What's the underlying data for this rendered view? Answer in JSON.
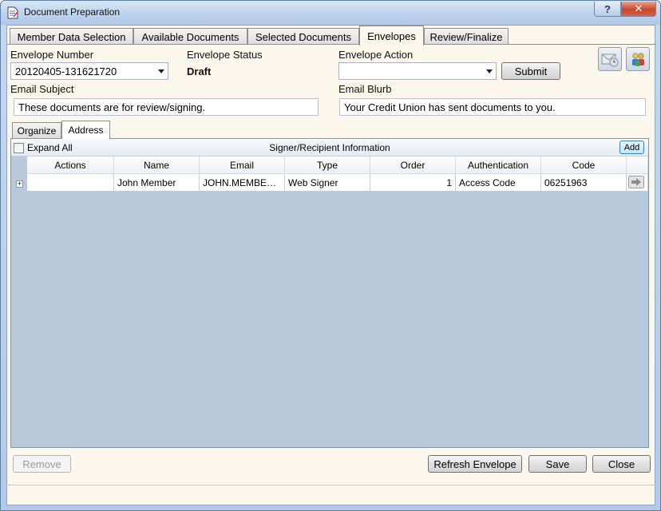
{
  "window": {
    "title": "Document Preparation",
    "help_label": "?",
    "close_label": "✕"
  },
  "tabs": [
    {
      "label": "Member Data Selection",
      "active": false
    },
    {
      "label": "Available Documents",
      "active": false
    },
    {
      "label": "Selected Documents",
      "active": false
    },
    {
      "label": "Envelopes",
      "active": true
    },
    {
      "label": "Review/Finalize",
      "active": false
    }
  ],
  "envelope": {
    "number_label": "Envelope Number",
    "number_value": "20120405-131621720",
    "status_label": "Envelope Status",
    "status_value": "Draft",
    "action_label": "Envelope Action",
    "action_value": "",
    "submit_label": "Submit",
    "subject_label": "Email Subject",
    "subject_value": "These documents are for review/signing.",
    "blurb_label": "Email Blurb",
    "blurb_value": "Your Credit Union has sent documents to you."
  },
  "toolbar_icons": [
    "mail-clock-icon",
    "people-icon"
  ],
  "subtabs": [
    {
      "label": "Organize",
      "active": false
    },
    {
      "label": "Address",
      "active": true
    }
  ],
  "grid": {
    "expand_all_label": "Expand All",
    "title": "Signer/Recipient Information",
    "add_label": "Add",
    "columns": [
      "Actions",
      "Name",
      "Email",
      "Type",
      "Order",
      "Authentication",
      "Code"
    ],
    "rows": [
      {
        "actions": "",
        "name": "John Member",
        "email": "JOHN.MEMBE…",
        "type": "Web Signer",
        "order": "1",
        "authentication": "Access Code",
        "code": "06251963"
      }
    ]
  },
  "footer": {
    "remove_label": "Remove",
    "refresh_label": "Refresh Envelope",
    "save_label": "Save",
    "close_label": "Close"
  }
}
